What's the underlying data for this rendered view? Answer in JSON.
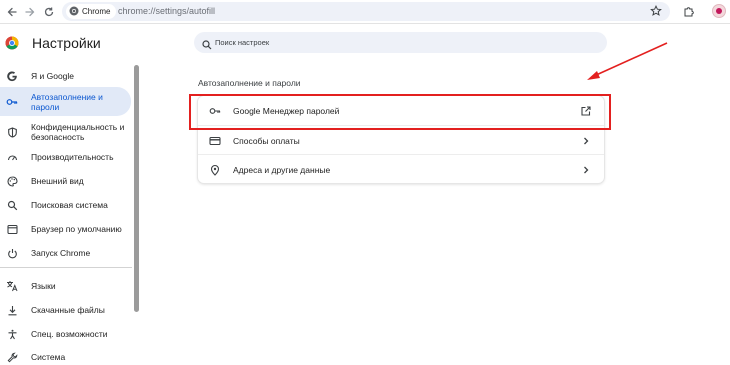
{
  "browser": {
    "chip_label": "Chrome",
    "url": "chrome://settings/autofill",
    "icons": [
      "back-icon",
      "forward-icon",
      "reload-icon",
      "star-icon",
      "extensions-icon",
      "profile-avatar"
    ]
  },
  "header": {
    "title": "Настройки",
    "search_placeholder": "Поиск настроек"
  },
  "sidebar": {
    "items": [
      {
        "label": "Я и Google",
        "icon": "google-icon"
      },
      {
        "label": "Автозаполнение и пароли",
        "icon": "key-icon",
        "active": true
      },
      {
        "label": "Конфиденциальность и безопасность",
        "icon": "shield-icon"
      },
      {
        "label": "Производительность",
        "icon": "speedometer-icon"
      },
      {
        "label": "Внешний вид",
        "icon": "palette-icon"
      },
      {
        "label": "Поисковая система",
        "icon": "search-icon"
      },
      {
        "label": "Браузер по умолчанию",
        "icon": "browser-icon"
      },
      {
        "label": "Запуск Chrome",
        "icon": "power-icon"
      },
      {
        "label": "Языки",
        "icon": "translate-icon"
      },
      {
        "label": "Скачанные файлы",
        "icon": "download-icon"
      },
      {
        "label": "Спец. возможности",
        "icon": "accessibility-icon"
      },
      {
        "label": "Система",
        "icon": "wrench-icon"
      }
    ]
  },
  "main": {
    "section_title": "Автозаполнение и пароли",
    "rows": [
      {
        "label": "Google Менеджер паролей",
        "icon": "key-icon",
        "end_icon": "external-link-icon"
      },
      {
        "label": "Способы оплаты",
        "icon": "credit-card-icon",
        "end_icon": "chevron-right-icon"
      },
      {
        "label": "Адреса и другие данные",
        "icon": "location-pin-icon",
        "end_icon": "chevron-right-icon"
      }
    ]
  },
  "annotation": {
    "highlight_color": "#e3201f",
    "arrow_color": "#e3201f"
  },
  "colors": {
    "accent": "#0b57d0",
    "active_bg": "#e1e9f7",
    "search_bg": "#eef1f8"
  }
}
